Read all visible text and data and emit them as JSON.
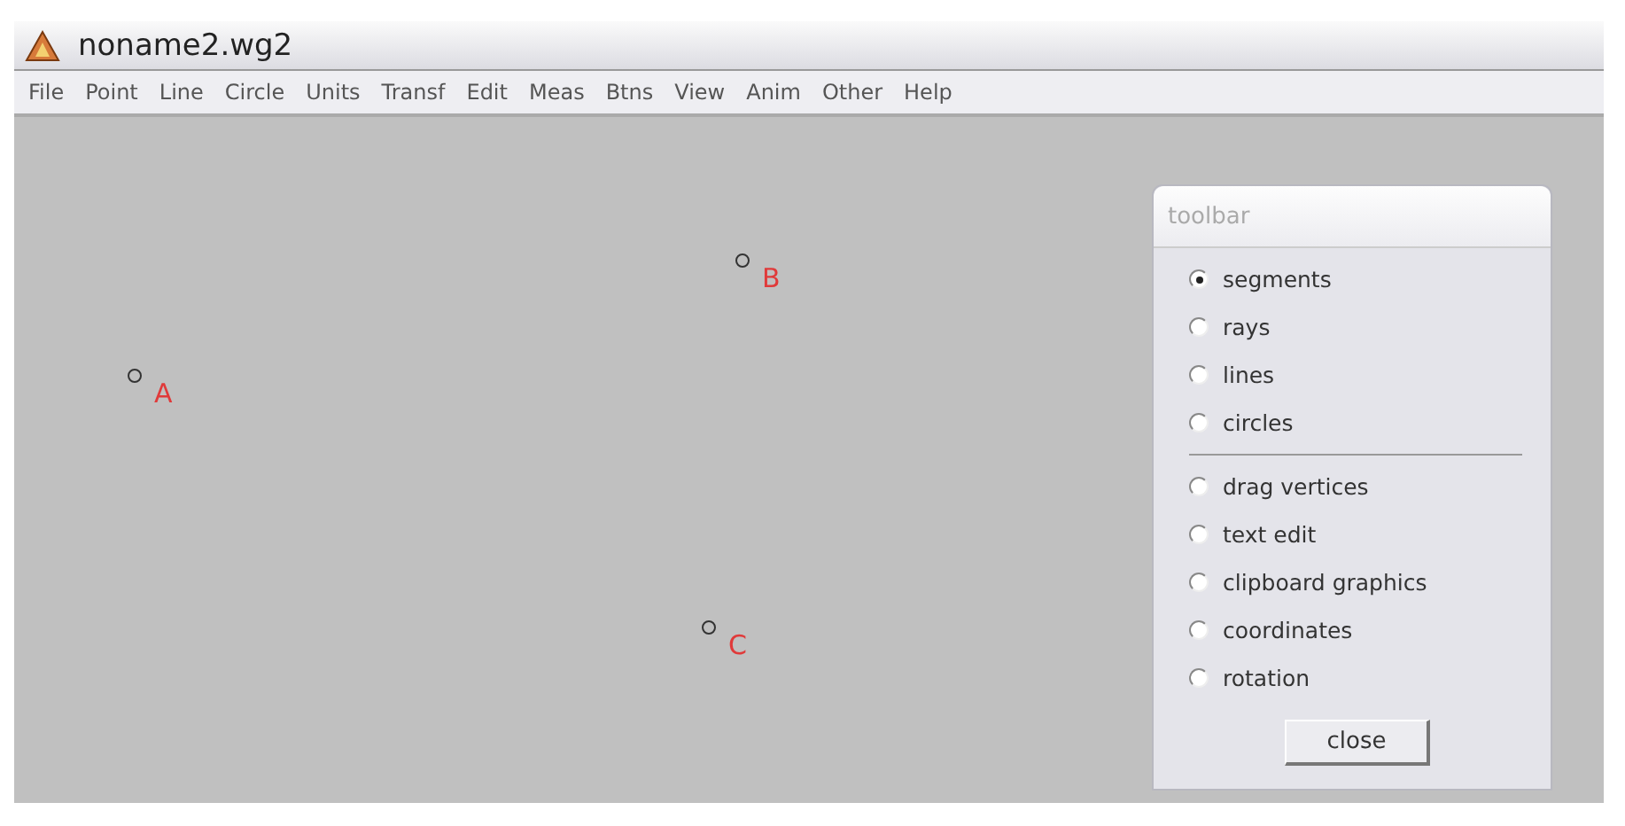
{
  "window": {
    "title": "noname2.wg2"
  },
  "menu": [
    "File",
    "Point",
    "Line",
    "Circle",
    "Units",
    "Transf",
    "Edit",
    "Meas",
    "Btns",
    "View",
    "Anim",
    "Other",
    "Help"
  ],
  "points": [
    {
      "label": "A"
    },
    {
      "label": "B"
    },
    {
      "label": "C"
    }
  ],
  "toolbar": {
    "title": "toolbar",
    "groups": [
      [
        {
          "label": "segments",
          "selected": true
        },
        {
          "label": "rays",
          "selected": false
        },
        {
          "label": "lines",
          "selected": false
        },
        {
          "label": "circles",
          "selected": false
        }
      ],
      [
        {
          "label": "drag vertices",
          "selected": false
        },
        {
          "label": "text edit",
          "selected": false
        },
        {
          "label": "clipboard graphics",
          "selected": false
        },
        {
          "label": "coordinates",
          "selected": false
        },
        {
          "label": "rotation",
          "selected": false
        }
      ]
    ],
    "button": "close"
  }
}
